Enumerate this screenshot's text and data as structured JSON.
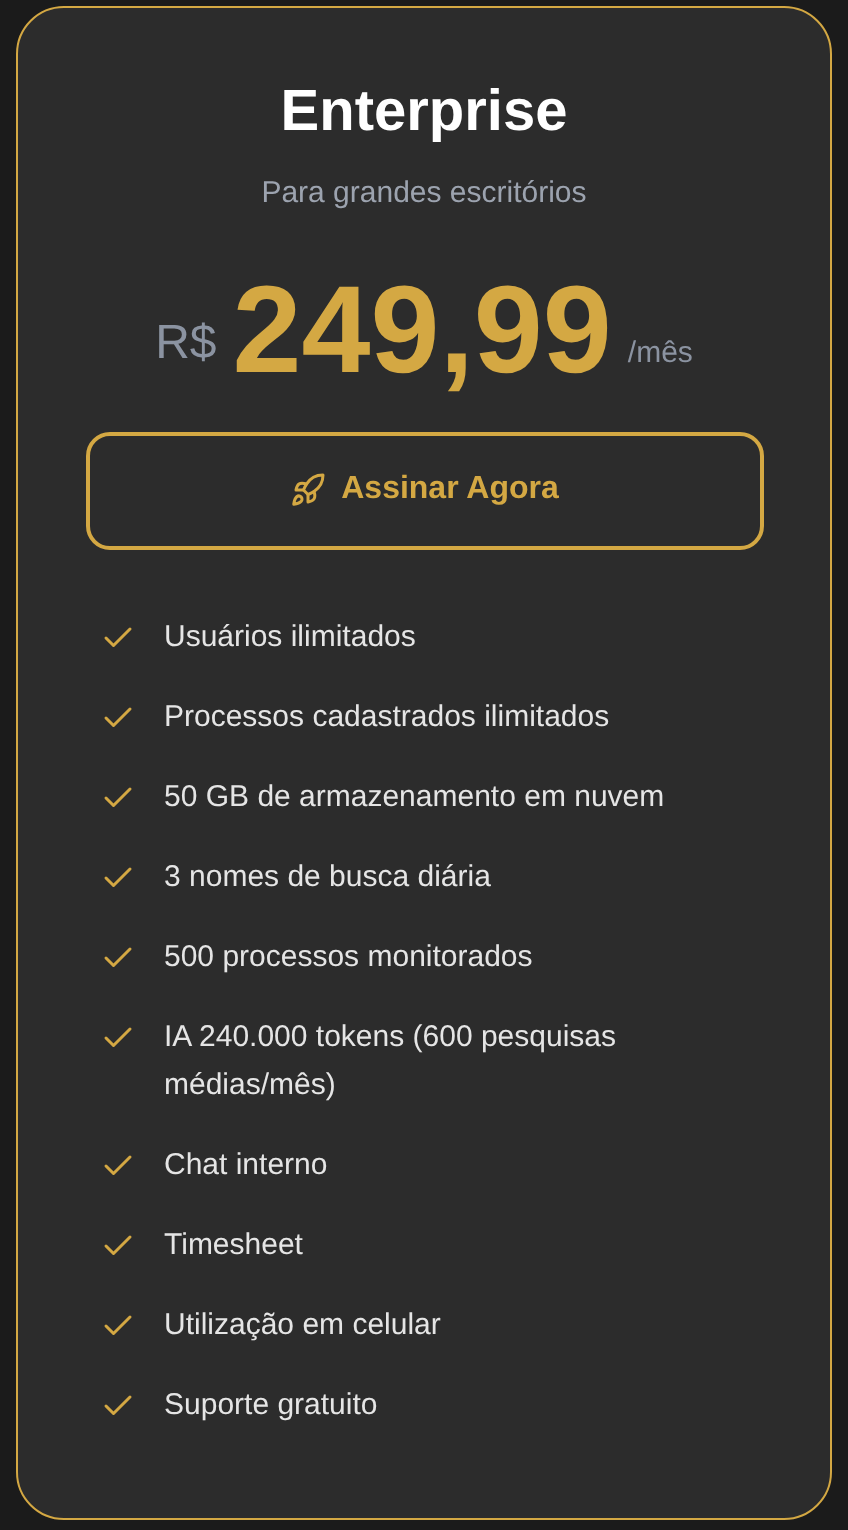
{
  "plan": {
    "title": "Enterprise",
    "subtitle": "Para grandes escritórios",
    "currency": "R$",
    "price": "249,99",
    "period": "/mês"
  },
  "button": {
    "label": "Assinar Agora"
  },
  "features": [
    {
      "text": "Usuários ilimitados"
    },
    {
      "text": "Processos cadastrados ilimitados"
    },
    {
      "text": "50 GB de armazenamento em nuvem"
    },
    {
      "text": "3 nomes de busca diária"
    },
    {
      "text": "500 processos monitorados"
    },
    {
      "text": "IA 240.000 tokens (600 pesquisas médias/mês)"
    },
    {
      "text": "Chat interno"
    },
    {
      "text": "Timesheet"
    },
    {
      "text": "Utilização em celular"
    },
    {
      "text": "Suporte gratuito"
    }
  ]
}
